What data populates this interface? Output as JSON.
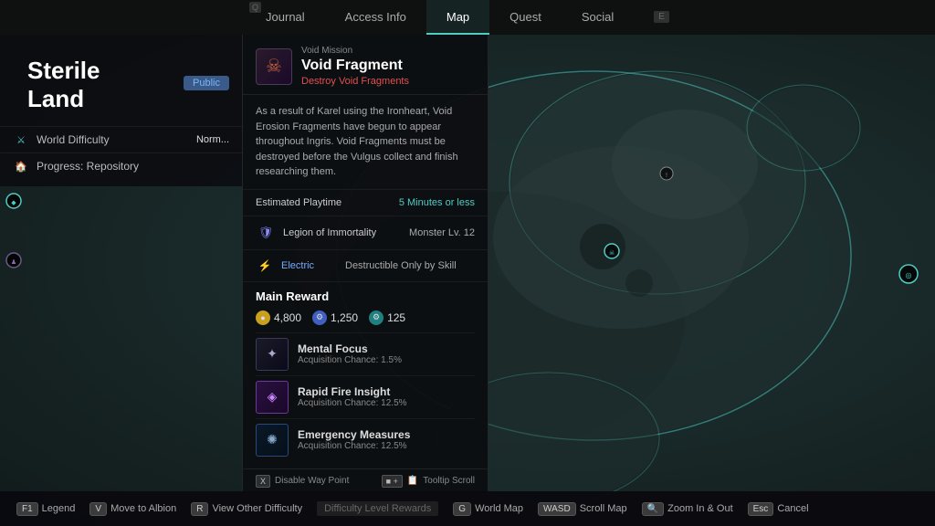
{
  "nav": {
    "tabs": [
      {
        "id": "journal",
        "label": "Journal",
        "key": "Q",
        "keyPos": "left",
        "active": false
      },
      {
        "id": "access-info",
        "label": "Access Info",
        "key": null,
        "active": false
      },
      {
        "id": "map",
        "label": "Map",
        "key": null,
        "active": true
      },
      {
        "id": "quest",
        "label": "Quest",
        "key": null,
        "active": false
      },
      {
        "id": "social",
        "label": "Social",
        "key": null,
        "active": false
      },
      {
        "id": "e-key",
        "label": "",
        "key": "E",
        "keyPos": "right",
        "active": false
      }
    ]
  },
  "left_panel": {
    "region_name": "Sterile Land",
    "badge": "Public",
    "world_difficulty_label": "World Difficulty",
    "world_difficulty_value": "Norm...",
    "progress_label": "Progress: Repository"
  },
  "info_card": {
    "mission_type": "Void Mission",
    "title": "Void Fragment",
    "subtitle": "Destroy Void Fragments",
    "icon": "☠",
    "description": "As a result of Karel using the Ironheart, Void Erosion Fragments have begun to appear throughout Ingris. Void Fragments must be destroyed before the Vulgus collect and finish researching them.",
    "estimated_playtime_label": "Estimated Playtime",
    "estimated_playtime_value": "5 Minutes or less",
    "enemy": {
      "name": "Legion of Immortality",
      "level": "Monster Lv. 12",
      "icon": "🛡"
    },
    "element": {
      "name": "Electric",
      "description": "Destructible Only by Skill",
      "icon": "⚡"
    },
    "main_reward": {
      "title": "Main Reward",
      "currencies": [
        {
          "icon": "●",
          "value": "4,800",
          "type": "gold"
        },
        {
          "icon": "⚙",
          "value": "1,250",
          "type": "blue"
        },
        {
          "icon": "⚙",
          "value": "125",
          "type": "teal"
        }
      ],
      "items": [
        {
          "name": "Mental Focus",
          "chance": "Acquisition Chance: 1.5%",
          "icon": "✦",
          "rarity": "gray"
        },
        {
          "name": "Rapid Fire Insight",
          "chance": "Acquisition Chance: 12.5%",
          "icon": "◈",
          "rarity": "purple"
        },
        {
          "name": "Emergency Measures",
          "chance": "Acquisition Chance: 12.5%",
          "icon": "✺",
          "rarity": "blue-dark"
        }
      ]
    },
    "footer": {
      "left_key": "X",
      "left_label": "Disable Way Point",
      "right_key_combo": "■ +",
      "right_icon": "📋",
      "right_label": "Tooltip Scroll"
    }
  },
  "bottom_bar": {
    "buttons": [
      {
        "key": "F1",
        "label": "Legend"
      },
      {
        "key": "V",
        "label": "Move to Albion"
      },
      {
        "key": "R",
        "label": "View Other Difficulty"
      },
      {
        "label_only": "Difficulty Level Rewards",
        "inactive": true
      },
      {
        "key": "G",
        "label": "World Map"
      },
      {
        "key": "WASD",
        "label": "Scroll Map"
      },
      {
        "key": "🔍",
        "label": "Zoom In & Out"
      },
      {
        "key": "Esc",
        "label": "Cancel"
      }
    ]
  }
}
